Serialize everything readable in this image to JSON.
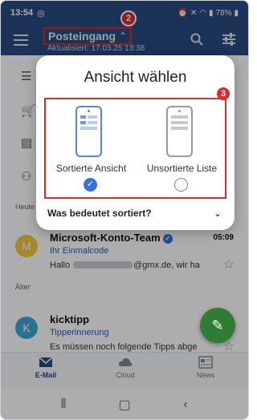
{
  "status_bar": {
    "time": "13:54",
    "battery": "78%"
  },
  "app_bar": {
    "title": "Posteingang",
    "subtitle": "Aktualisiert: 17.03.25 13:38",
    "badge": "2"
  },
  "sections": {
    "today": "Heute",
    "older": "Älter"
  },
  "emails": [
    {
      "avatar_letter": "M",
      "avatar_color": "#f4c842",
      "sender": "Microsoft-Konto-Team",
      "subject": "Ihr Einmalcode",
      "preview_start": "Hallo ",
      "preview_end": "@gmx.de, wir ha",
      "time": "05:09"
    },
    {
      "avatar_letter": "K",
      "avatar_color": "#3fa7d6",
      "sender": "kicktipp",
      "subject": "Tipperinnerung",
      "preview": "Es müssen noch folgende Tipps abge"
    }
  ],
  "modal": {
    "title": "Ansicht wählen",
    "badge": "3",
    "options": [
      {
        "label": "Sortierte Ansicht",
        "selected": true
      },
      {
        "label": "Unsortierte Liste",
        "selected": false
      }
    ],
    "faq": "Was bedeutet sortiert?"
  },
  "bottom_nav": [
    {
      "label": "E-Mail",
      "icon": "mail-icon",
      "active": true
    },
    {
      "label": "Cloud",
      "icon": "cloud-icon",
      "active": false
    },
    {
      "label": "News",
      "icon": "news-icon",
      "active": false
    }
  ],
  "colors": {
    "primary": "#2a4a7f",
    "accent": "#3b6fd8",
    "highlight": "#d32f2f",
    "fab": "#2e7d32"
  }
}
